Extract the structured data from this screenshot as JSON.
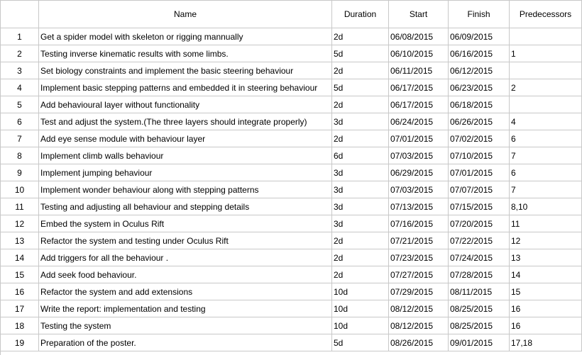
{
  "columns": {
    "id": "",
    "name": "Name",
    "duration": "Duration",
    "start": "Start",
    "finish": "Finish",
    "predecessors": "Predecessors"
  },
  "rows": [
    {
      "id": "1",
      "name": "Get a spider model with skeleton or rigging mannually",
      "duration": "2d",
      "start": "06/08/2015",
      "finish": "06/09/2015",
      "predecessors": ""
    },
    {
      "id": "2",
      "name": "Testing inverse kinematic results with some limbs.",
      "duration": "5d",
      "start": "06/10/2015",
      "finish": "06/16/2015",
      "predecessors": "1"
    },
    {
      "id": "3",
      "name": "Set biology constraints and implement the basic steering behaviour",
      "duration": "2d",
      "start": "06/11/2015",
      "finish": "06/12/2015",
      "predecessors": ""
    },
    {
      "id": "4",
      "name": "Implement basic stepping patterns and embedded it in steering behaviour",
      "duration": "5d",
      "start": "06/17/2015",
      "finish": "06/23/2015",
      "predecessors": "2"
    },
    {
      "id": "5",
      "name": "Add behavioural layer without functionality",
      "duration": "2d",
      "start": "06/17/2015",
      "finish": "06/18/2015",
      "predecessors": ""
    },
    {
      "id": "6",
      "name": "Test and adjust the system.(The three layers should integrate properly)",
      "duration": "3d",
      "start": "06/24/2015",
      "finish": "06/26/2015",
      "predecessors": "4"
    },
    {
      "id": "7",
      "name": "Add eye sense module with behaviour layer",
      "duration": "2d",
      "start": "07/01/2015",
      "finish": "07/02/2015",
      "predecessors": "6"
    },
    {
      "id": "8",
      "name": "Implement climb walls behaviour",
      "duration": "6d",
      "start": "07/03/2015",
      "finish": "07/10/2015",
      "predecessors": "7"
    },
    {
      "id": "9",
      "name": "Implement jumping behaviour",
      "duration": "3d",
      "start": "06/29/2015",
      "finish": "07/01/2015",
      "predecessors": "6"
    },
    {
      "id": "10",
      "name": "Implement wonder behaviour along with stepping patterns",
      "duration": "3d",
      "start": "07/03/2015",
      "finish": "07/07/2015",
      "predecessors": "7"
    },
    {
      "id": "11",
      "name": "Testing and adjusting all behaviour and stepping details",
      "duration": "3d",
      "start": "07/13/2015",
      "finish": "07/15/2015",
      "predecessors": "8,10"
    },
    {
      "id": "12",
      "name": "Embed the system in Oculus Rift",
      "duration": "3d",
      "start": "07/16/2015",
      "finish": "07/20/2015",
      "predecessors": "11"
    },
    {
      "id": "13",
      "name": "Refactor the system and testing under Oculus Rift",
      "duration": "2d",
      "start": "07/21/2015",
      "finish": "07/22/2015",
      "predecessors": "12"
    },
    {
      "id": "14",
      "name": "Add triggers for all the behaviour .",
      "duration": "2d",
      "start": "07/23/2015",
      "finish": "07/24/2015",
      "predecessors": "13"
    },
    {
      "id": "15",
      "name": "Add seek food behaviour.",
      "duration": "2d",
      "start": "07/27/2015",
      "finish": "07/28/2015",
      "predecessors": "14"
    },
    {
      "id": "16",
      "name": "Refactor the system and add extensions",
      "duration": "10d",
      "start": "07/29/2015",
      "finish": "08/11/2015",
      "predecessors": "15"
    },
    {
      "id": "17",
      "name": "Write the report: implementation and testing",
      "duration": "10d",
      "start": "08/12/2015",
      "finish": "08/25/2015",
      "predecessors": "16"
    },
    {
      "id": "18",
      "name": "Testing the system",
      "duration": "10d",
      "start": "08/12/2015",
      "finish": "08/25/2015",
      "predecessors": "16"
    },
    {
      "id": "19",
      "name": "Preparation of the poster.",
      "duration": "5d",
      "start": "08/26/2015",
      "finish": "09/01/2015",
      "predecessors": "17,18"
    }
  ]
}
